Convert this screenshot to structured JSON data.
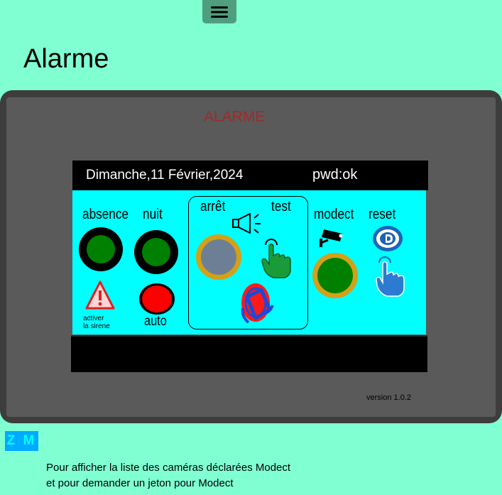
{
  "header": {
    "menu_icon": "hamburger-menu-icon",
    "page_title": "Alarme"
  },
  "device": {
    "title": "ALARME",
    "date": "Dimanche,11 Février,2024",
    "pwd_status": "pwd:ok",
    "version": "version 1.0.2",
    "buttons": {
      "absence_label": "absence",
      "nuit_label": "nuit",
      "arret_label": "arrêt",
      "test_label": "test",
      "modect_label": "modect",
      "reset_label": "reset",
      "auto_label": "auto",
      "siren_label_line1": "activer",
      "siren_label_line2": "la sirene"
    },
    "colors": {
      "indicator_on": "#008000",
      "indicator_auto": "#ff0000",
      "arret_indicator": "#6d7f95",
      "ring_gold": "#d4a017",
      "screen_bg": "#00ffff"
    },
    "icons": [
      "warning-triangle-icon",
      "speaker-icon",
      "pointer-hand-icon",
      "camera-icon",
      "reset-logo-icon",
      "rfid-badge-icon"
    ]
  },
  "footer": {
    "zm_label": "Z M",
    "info_line1": "Pour afficher la liste des caméras déclarées Modect",
    "info_line2": "et pour demander un jeton pour Modect"
  }
}
